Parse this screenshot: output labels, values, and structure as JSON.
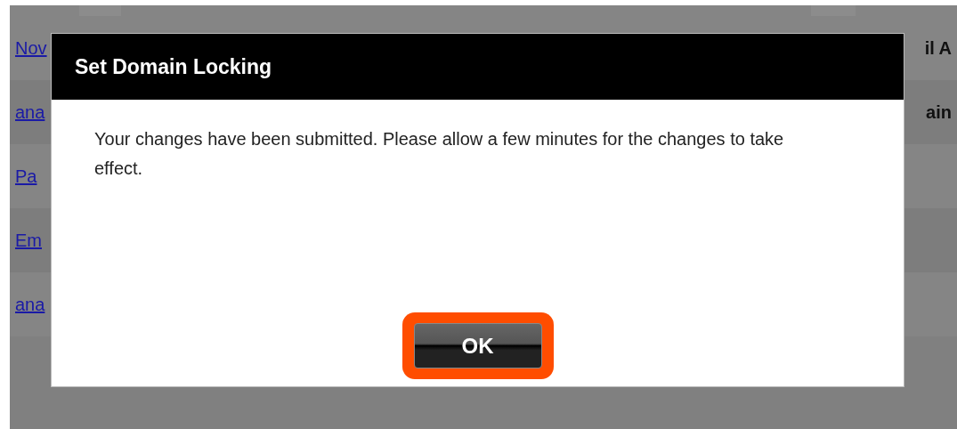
{
  "background_page": {
    "links": [
      {
        "text": "Nov"
      },
      {
        "text": "ana"
      },
      {
        "text": "Pa"
      },
      {
        "text": "Em"
      },
      {
        "text": "ana"
      }
    ],
    "headings": [
      "il A",
      "ain"
    ]
  },
  "dialog": {
    "title": "Set Domain Locking",
    "message": "Your changes have been submitted. Please allow a few minutes for the changes to take effect.",
    "buttons": [
      {
        "label": "OK",
        "highlighted": true
      }
    ]
  }
}
